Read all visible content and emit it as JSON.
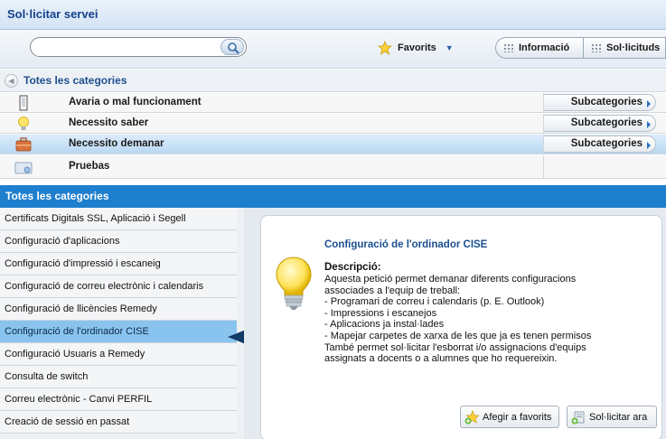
{
  "window": {
    "title": "Sol·licitar servei"
  },
  "toolbar": {
    "search_value": "",
    "favorites_label": "Favorits",
    "info_label": "Informació",
    "requests_label": "Sol·licituds"
  },
  "categories": {
    "header": "Totes les categories",
    "subcategories_label": "Subcategories",
    "rows": [
      {
        "label": "Avaria o mal funcionament",
        "icon": "device-icon",
        "has_subcategories": true
      },
      {
        "label": "Necessito saber",
        "icon": "lightbulb-icon",
        "has_subcategories": true
      },
      {
        "label": "Necessito demanar",
        "icon": "briefcase-icon",
        "has_subcategories": true,
        "selected": true
      },
      {
        "label": "Pruebas",
        "icon": "folder-icon",
        "has_subcategories": false
      }
    ]
  },
  "list": {
    "header": "Totes les categories",
    "items": [
      "Certificats Digitals SSL, Aplicació i Segell",
      "Configuració d'aplicacions",
      "Configuració d'impressió i escaneig",
      "Configuració de correu electrònic i calendaris",
      "Configuració de llicències Remedy",
      "Configuració de l'ordinador CISE",
      "Configuració Usuaris a Remedy",
      "Consulta de switch",
      "Correu electrònic - Canvi PERFIL",
      "Creació de sessió en passat"
    ],
    "active_index": 5
  },
  "detail": {
    "title": "Configuració de l'ordinador CISE",
    "description_label": "Descripció:",
    "description_lines": [
      "Aquesta petició permet demanar diferents configuracions",
      "associades a l'equip de treball:",
      "- Programari de correu i calendaris (p. E. Outlook)",
      "- Impressions i escanejos",
      "- Aplicacions ja instal·lades",
      "- Mapejar carpetes de xarxa de les que ja es tenen permisos",
      "També permet sol·licitar l'esborrat i/o assignacions d'equips",
      "assignats a docents o a alumnes que ho requereixin."
    ],
    "add_favorites_label": "Afegir a favorits",
    "request_now_label": "Sol·licitar ara"
  },
  "colors": {
    "accent": "#1f7fcf",
    "title_text": "#15428b",
    "active_item": "#89c4ee"
  }
}
